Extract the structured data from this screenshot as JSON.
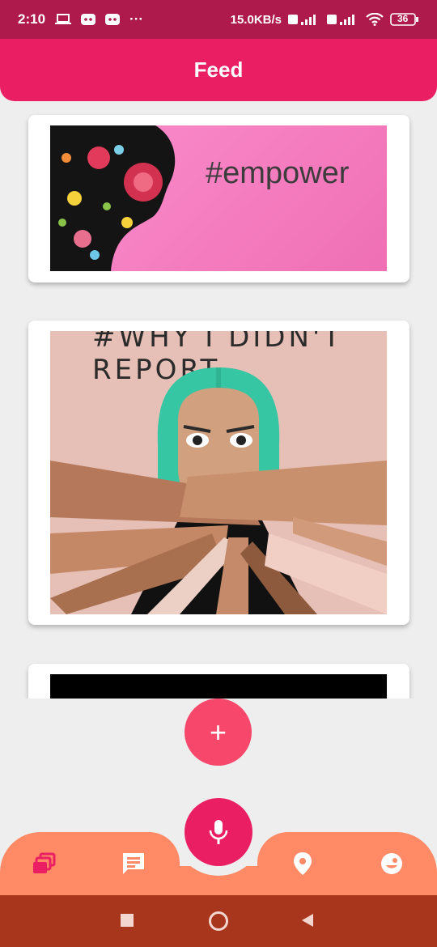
{
  "status_bar": {
    "time": "2:10",
    "more": "···",
    "network_speed": "15.0KB/s",
    "battery": "36"
  },
  "app_bar": {
    "title": "Feed"
  },
  "feed": {
    "posts": [
      {
        "image_text": "#empower"
      },
      {
        "image_text": "#WHY I DIDN'T REPORT"
      },
      {
        "image_text": ""
      }
    ]
  },
  "fab": {
    "add_label": "+"
  },
  "bottom_nav": {
    "items": [
      {
        "icon": "collections-icon",
        "active": true
      },
      {
        "icon": "chat-icon",
        "active": false
      },
      {
        "icon": "microphone-icon",
        "active": false
      },
      {
        "icon": "location-pin-icon",
        "active": false
      },
      {
        "icon": "mood-face-icon",
        "active": false
      }
    ]
  },
  "colors": {
    "status_bar": "#ad1a4b",
    "app_bar": "#e91e63",
    "bottom_nav": "#ff8a65",
    "fab_add": "#f7476a",
    "fab_mic": "#e91e63",
    "system_nav": "#a8361c",
    "background": "#eeeeee"
  }
}
